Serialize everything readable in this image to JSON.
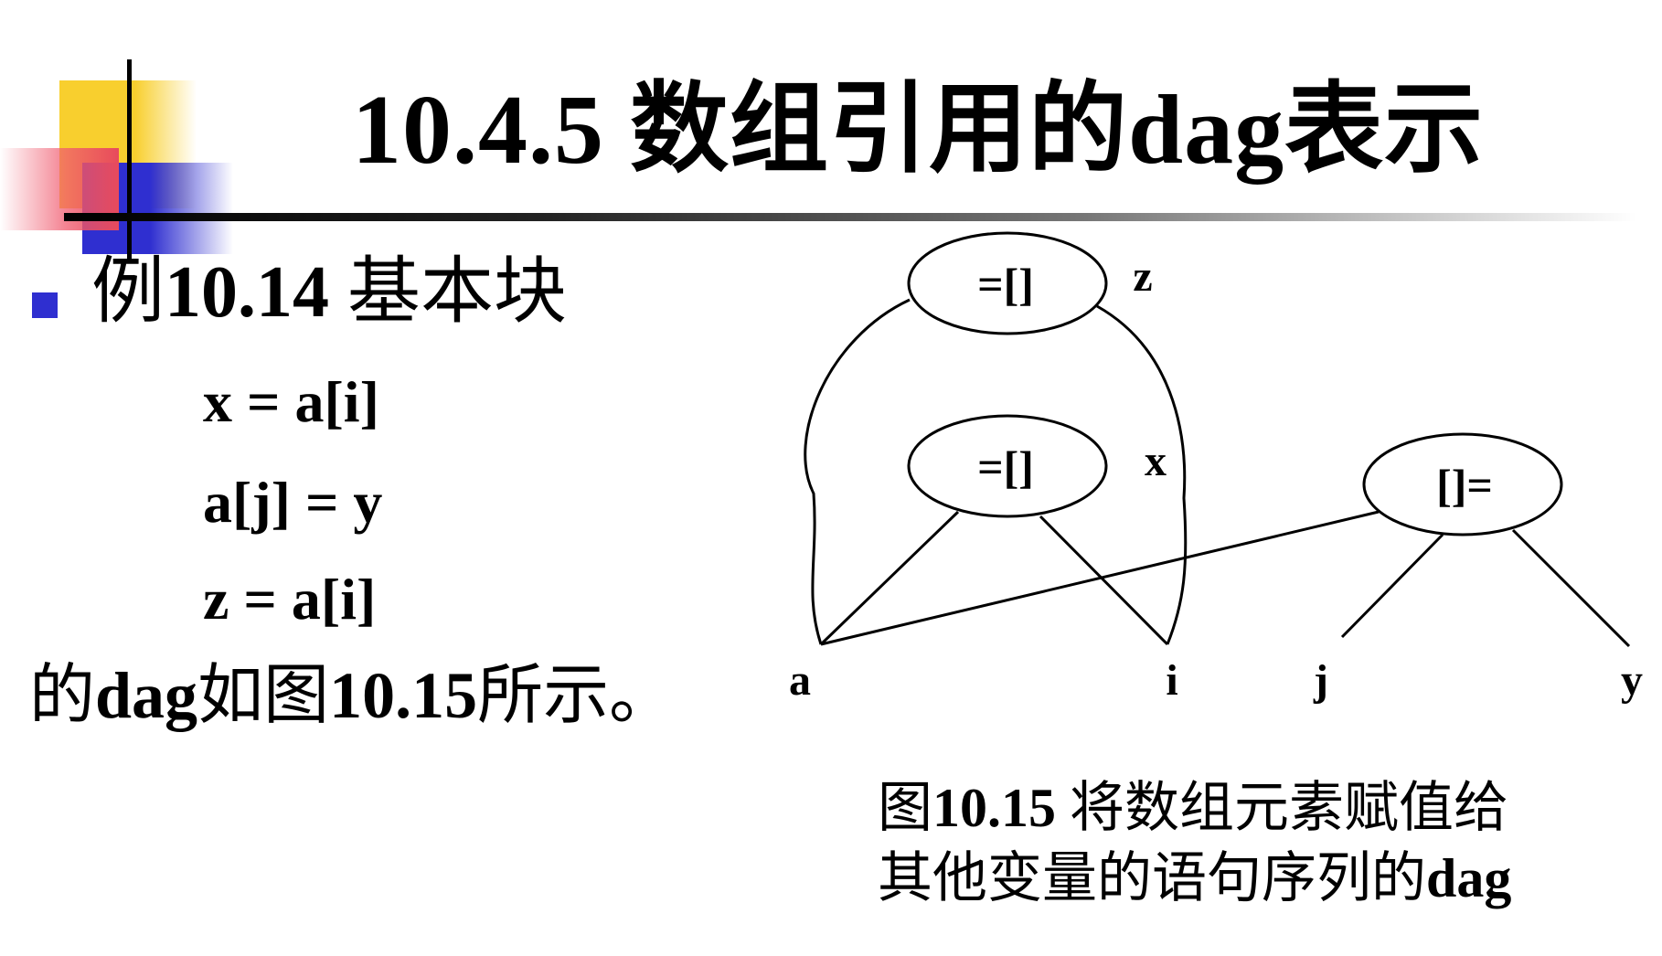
{
  "title": "10.4.5 数组引用的dag表示",
  "bullet": {
    "prefix": "例",
    "number": "10.14",
    "suffix": " 基本块"
  },
  "code_lines": [
    "x = a[i]",
    "a[j] = y",
    "z = a[i]"
  ],
  "conclusion": {
    "part1": "的",
    "part2": "dag",
    "part3": "如图",
    "part4": "10.15",
    "part5": "所示。"
  },
  "diagram": {
    "nodes": {
      "top": {
        "label": "=[]",
        "annotation": "z"
      },
      "mid": {
        "label": "=[]",
        "annotation": "x"
      },
      "right": {
        "label": "[]="
      }
    },
    "leaves": {
      "a": "a",
      "i": "i",
      "j": "j",
      "y": "y"
    }
  },
  "caption": {
    "line1_prefix": "图",
    "line1_number": "10.15",
    "line1_text": " 将数组元素赋值给",
    "line2_text": "其他变量的语句序列的",
    "line2_suffix": "dag"
  },
  "colors": {
    "accent_blue": "#2f2fd0",
    "accent_yellow": "#f8cf2e",
    "accent_red": "#e84a5c"
  }
}
